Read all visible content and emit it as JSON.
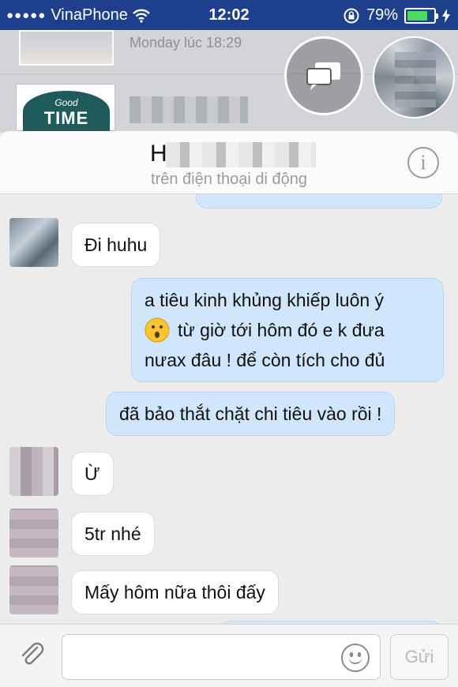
{
  "status_bar": {
    "signal": "●●●●●",
    "carrier": "VinaPhone",
    "time": "12:02",
    "battery": "79%",
    "battery_level": 0.79
  },
  "background_list": {
    "row1_meta": "Monday lúc 18:29",
    "row2_badge_top": "Good",
    "row2_badge_main": "TIME"
  },
  "chat_head": {
    "bubble_icon": "chat-bubbles-icon",
    "avatar": "contact-avatar"
  },
  "header": {
    "name": "H",
    "subtitle": "trên điện thoại di động",
    "info_glyph": "i"
  },
  "messages": [
    {
      "from": "them",
      "text": "Đi huhu"
    },
    {
      "from": "me",
      "lines": [
        "a tiêu kinh khủng khiếp luôn ý",
        "từ giờ tới hôm đó e k đưa",
        "nưax đâu ! để còn tích cho đủ"
      ]
    },
    {
      "from": "me",
      "text": "đã bảo thắt chặt chi tiêu vào rồi !"
    },
    {
      "from": "them",
      "text": "Ừ"
    },
    {
      "from": "them",
      "text": "5tr nhé"
    },
    {
      "from": "them",
      "text": "Mấy hôm nữa thôi đấy"
    }
  ],
  "composer": {
    "placeholder": "",
    "send_label": "Gửi",
    "attach_icon": "paperclip-icon",
    "emoji_icon": "smiley-icon"
  },
  "colors": {
    "status_bar": "#1d3f8c",
    "outgoing_bubble": "#cfe6fc",
    "incoming_bubble": "#ffffff",
    "battery": "#4cd964"
  }
}
